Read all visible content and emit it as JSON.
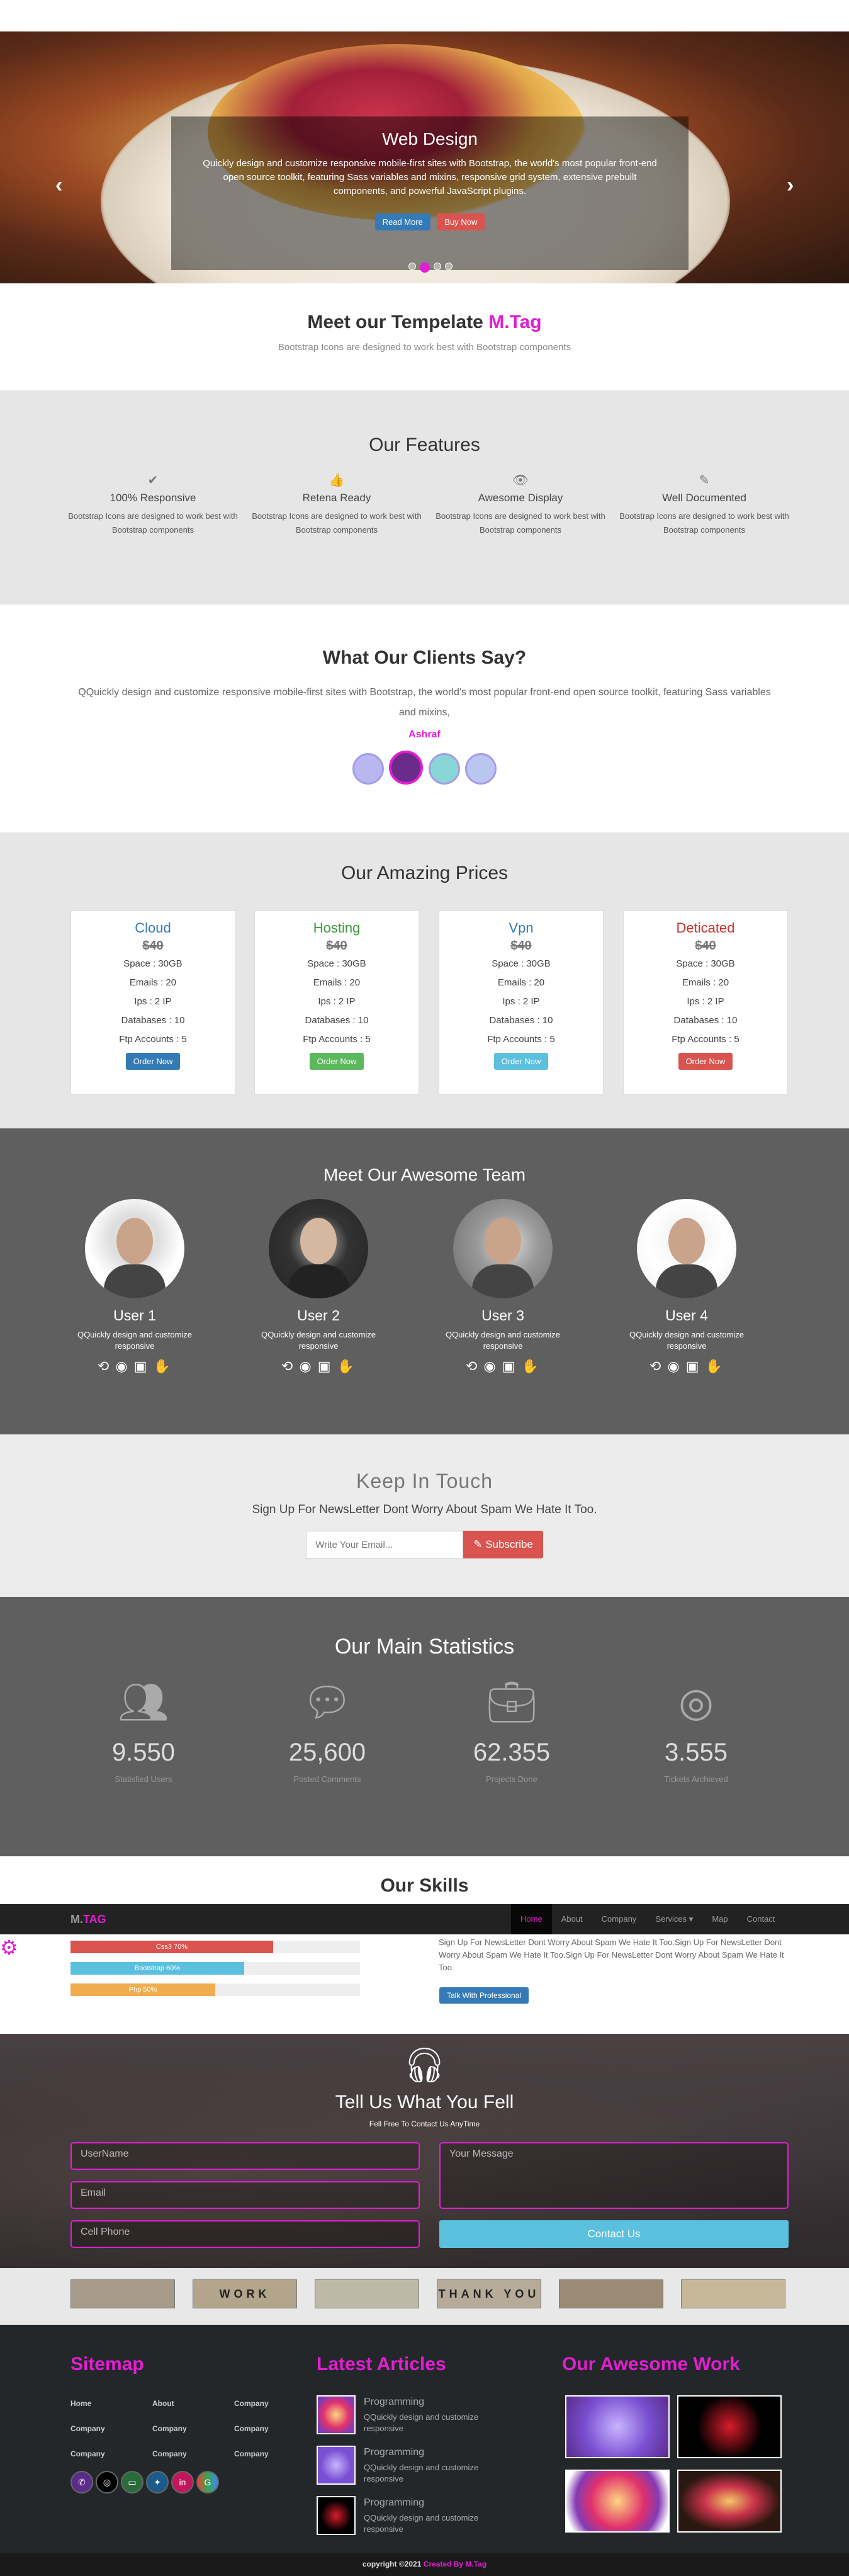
{
  "hero": {
    "title": "Web Design",
    "text": "Quickly design and customize responsive mobile-first sites with Bootstrap, the world's most popular front-end open source toolkit, featuring Sass variables and mixins, responsive grid system, extensive prebuilt components, and powerful JavaScript plugins.",
    "read_more": "Read More",
    "buy_now": "Buy Now",
    "prev": "‹",
    "next": "›"
  },
  "meet": {
    "title": "Meet our Tempelate ",
    "brand": "M.Tag",
    "subtitle": "Bootstrap Icons are designed to work best with Bootstrap components"
  },
  "features": {
    "title": "Our Features",
    "items": [
      {
        "icon": "✔",
        "title": "100% Responsive",
        "text": "Bootstrap Icons are designed to work best with Bootstrap components"
      },
      {
        "icon": "👍",
        "title": "Retena Ready",
        "text": "Bootstrap Icons are designed to work best with Bootstrap components"
      },
      {
        "icon": "👁",
        "title": "Awesome Display",
        "text": "Bootstrap Icons are designed to work best with Bootstrap components"
      },
      {
        "icon": "✎",
        "title": "Well Documented",
        "text": "Bootstrap Icons are designed to work best with Bootstrap components"
      }
    ]
  },
  "clients": {
    "title": "What Our Clients Say?",
    "quote": "QQuickly design and customize responsive mobile-first sites with Bootstrap, the world's most popular front-end open source toolkit, featuring Sass variables and mixins,",
    "author": "Ashraf"
  },
  "prices": {
    "title": "Our Amazing Prices",
    "plans": [
      {
        "name": "Cloud",
        "color": "#337ab7",
        "price": "$40",
        "space": "Space : 30GB",
        "emails": "Emails : 20",
        "ips": "Ips : 2 IP",
        "db": "Databases : 10",
        "ftp": "Ftp Accounts : 5",
        "btn": "Order Now"
      },
      {
        "name": "Hosting",
        "color": "#3c963c",
        "price": "$40",
        "space": "Space : 30GB",
        "emails": "Emails : 20",
        "ips": "Ips : 2 IP",
        "db": "Databases : 10",
        "ftp": "Ftp Accounts : 5",
        "btn": "Order Now"
      },
      {
        "name": "Vpn",
        "color": "#337ab7",
        "price": "$40",
        "space": "Space : 30GB",
        "emails": "Emails : 20",
        "ips": "Ips : 2 IP",
        "db": "Databases : 10",
        "ftp": "Ftp Accounts : 5",
        "btn": "Order Now"
      },
      {
        "name": "Deticated",
        "color": "#c9302c",
        "price": "$40",
        "space": "Space : 30GB",
        "emails": "Emails : 20",
        "ips": "Ips : 2 IP",
        "db": "Databases : 10",
        "ftp": "Ftp Accounts : 5",
        "btn": "Order Now"
      }
    ]
  },
  "team": {
    "title": "Meet Our Awesome Team",
    "members": [
      {
        "name": "User 1",
        "text": "QQuickly design and customize responsive",
        "social": "⟲ ◉ ▣ ✋"
      },
      {
        "name": "User 2",
        "text": "QQuickly design and customize responsive",
        "social": "⟲ ◉ ▣ ✋"
      },
      {
        "name": "User 3",
        "text": "QQuickly design and customize responsive",
        "social": "⟲ ◉ ▣ ✋"
      },
      {
        "name": "User 4",
        "text": "QQuickly design and customize responsive",
        "social": "⟲ ◉ ▣ ✋"
      }
    ]
  },
  "touch": {
    "title": "Keep In Touch",
    "text": "Sign Up For NewsLetter Dont Worry About Spam We Hate It Too.",
    "placeholder": "Write Your Email...",
    "subscribe": "Subscribe"
  },
  "stats": {
    "title": "Our Main Statistics",
    "items": [
      {
        "num": "9.550",
        "label": "Statisfied Users"
      },
      {
        "num": "25,600",
        "label": "Posted Comments"
      },
      {
        "num": "62.355",
        "label": "Projects Done"
      },
      {
        "num": "3.555",
        "label": "Tickets Archieved"
      }
    ]
  },
  "skills": {
    "title": "Our Skills",
    "bars": [
      {
        "label": "Css3 70%",
        "value": 0.7,
        "color": "#d9534f"
      },
      {
        "label": "Bootstrap 60%",
        "value": 0.6,
        "color": "#5bc0de"
      },
      {
        "label": "Php 50%",
        "value": 0.5,
        "color": "#f0ad4e"
      }
    ],
    "text": "Sign Up For NewsLetter Dont Worry About Spam We Hate It Too.Sign Up For NewsLetter Dont Worry About Spam We Hate It Too.Sign Up For NewsLetter Dont Worry About Spam We Hate It Too.",
    "btn": "Talk With Professional"
  },
  "navbar": {
    "brand_m": "M.",
    "brand_tag": "TAG",
    "items": [
      "Home",
      "About",
      "Company",
      "Services ▾",
      "Map",
      "Contact"
    ]
  },
  "contact": {
    "title": "Tell Us What You Fell",
    "subtitle": "Fell Free To Contact Us AnyTime",
    "username": "UserName",
    "email": "Email",
    "phone": "Cell Phone",
    "message": "Your Message",
    "btn": "Contact Us"
  },
  "clients_logos": [
    "",
    "WORK",
    "",
    "THANK YOU",
    "",
    ""
  ],
  "footer": {
    "sitemap": "Sitemap",
    "links": [
      "Home",
      "About",
      "Company",
      "Company",
      "Company",
      "Company",
      "Company",
      "Company",
      "Company"
    ],
    "articles_title": "Latest Articles",
    "articles": [
      {
        "title": "Programming",
        "text": "QQuickly design and customize responsive"
      },
      {
        "title": "Programming",
        "text": "QQuickly design and customize responsive"
      },
      {
        "title": "Programming",
        "text": "QQuickly design and customize responsive"
      }
    ],
    "work_title": "Our Awesome Work",
    "copyright": "copyright ©2021 ",
    "credit": "Created By M.Tag"
  }
}
